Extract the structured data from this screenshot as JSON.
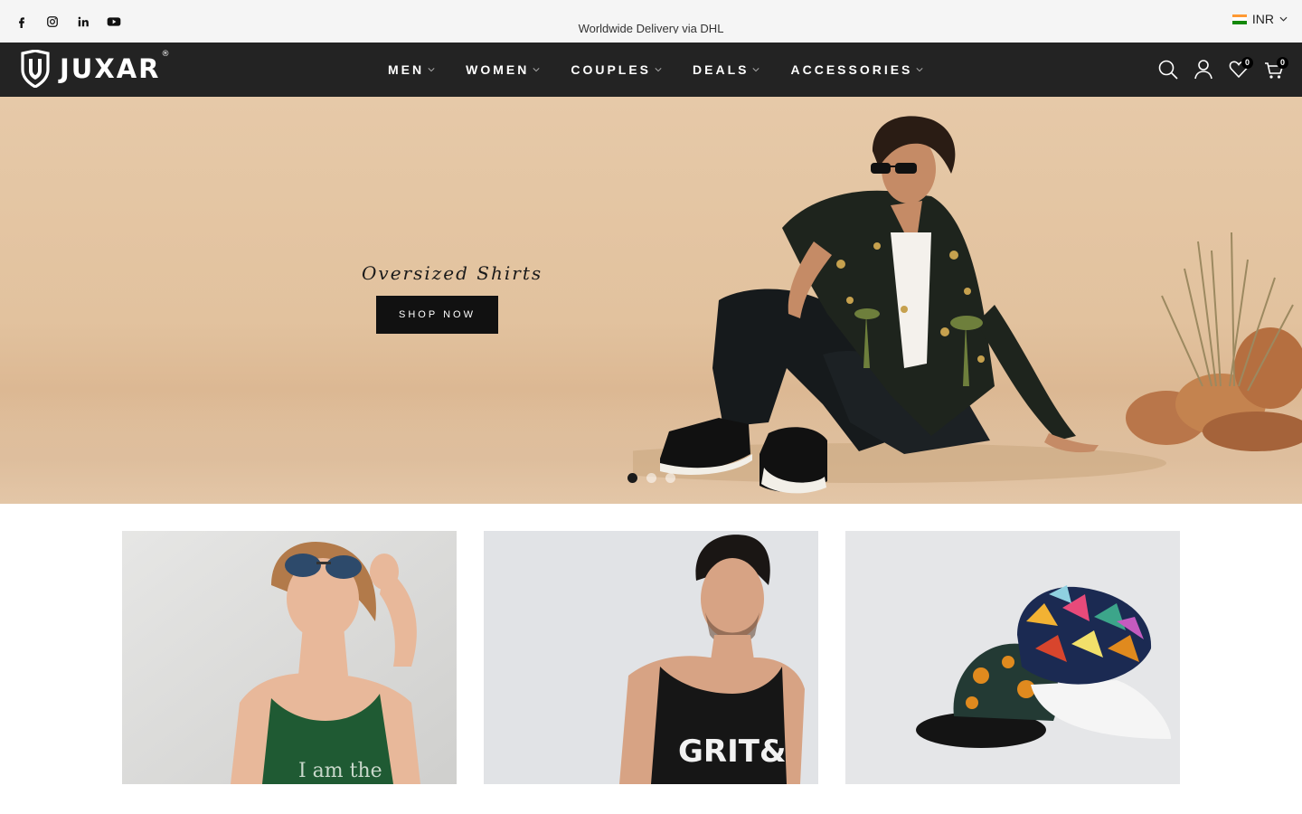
{
  "topbar": {
    "social": [
      {
        "name": "facebook-icon"
      },
      {
        "name": "instagram-icon"
      },
      {
        "name": "linkedin-icon"
      },
      {
        "name": "youtube-icon"
      }
    ],
    "announcement": "Worldwide Delivery via DHL",
    "currency": "INR"
  },
  "header": {
    "logo_text": "JUXAR",
    "logo_reg": "®",
    "nav": [
      {
        "label": "MEN"
      },
      {
        "label": "WOMEN"
      },
      {
        "label": "COUPLES"
      },
      {
        "label": "DEALS"
      },
      {
        "label": "ACCESSORIES"
      }
    ],
    "wishlist_count": "0",
    "cart_count": "0"
  },
  "hero": {
    "title": "Oversized Shirts",
    "button": "SHOP NOW",
    "slides_total": 3,
    "active_slide": 1
  },
  "colors": {
    "header_bg": "#232323",
    "topbar_bg": "#f5f5f5",
    "hero_bg": "#e2c29e",
    "button_bg": "#111111"
  }
}
